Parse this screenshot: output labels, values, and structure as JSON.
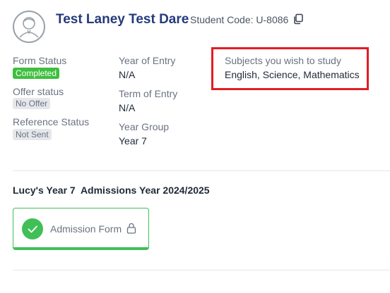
{
  "student": {
    "name": "Test Laney Test Dare",
    "code_label": "Student Code:",
    "code": "U-8086",
    "avatar_icon": "user-avatar-icon",
    "copy_icon": "copy-icon"
  },
  "details": {
    "form_status": {
      "label": "Form Status",
      "value": "Completed"
    },
    "offer_status": {
      "label": "Offer status",
      "value": "No Offer"
    },
    "reference_status": {
      "label": "Reference Status",
      "value": "Not Sent"
    },
    "year_of_entry": {
      "label": "Year of Entry",
      "value": "N/A"
    },
    "term_of_entry": {
      "label": "Term of Entry",
      "value": "N/A"
    },
    "year_group": {
      "label": "Year Group",
      "value": "Year 7"
    },
    "subjects": {
      "label": "Subjects you wish to study",
      "value": "English, Science, Mathematics"
    }
  },
  "admissions": {
    "title": "Lucy's Year 7  Admissions Year 2024/2025",
    "forms": [
      {
        "label": "Admission Form",
        "status": "completed",
        "status_icon": "check-icon",
        "lock_icon": "lock-icon"
      }
    ]
  },
  "colors": {
    "accent_green": "#40bf57",
    "name_blue": "#243a7a",
    "highlight_red": "#e31c24"
  }
}
